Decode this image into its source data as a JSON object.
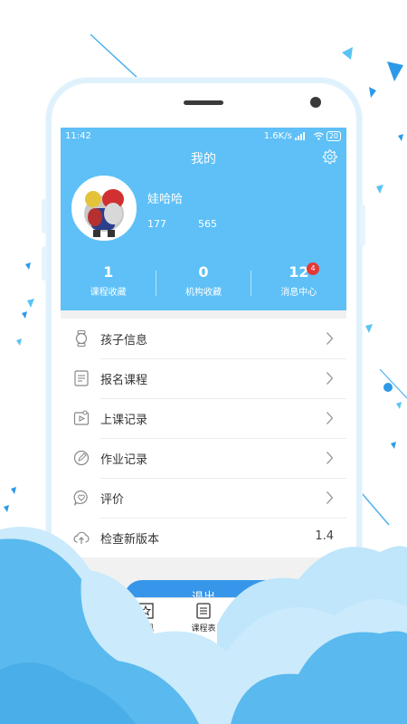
{
  "statusbar": {
    "time": "11:42",
    "network_speed": "1.6K/s",
    "battery": "20"
  },
  "header": {
    "title": "我的",
    "user_name": "娃哈哈",
    "stat_a": "177",
    "stat_b": "565"
  },
  "counts": [
    {
      "value": "1",
      "label": "课程收藏"
    },
    {
      "value": "0",
      "label": "机构收藏"
    },
    {
      "value": "12",
      "label": "消息中心",
      "badge": "4"
    }
  ],
  "menu": [
    {
      "label": "孩子信息",
      "icon": "watch-icon"
    },
    {
      "label": "报名课程",
      "icon": "form-icon"
    },
    {
      "label": "上课记录",
      "icon": "media-icon"
    },
    {
      "label": "作业记录",
      "icon": "edit-circle-icon"
    },
    {
      "label": "评价",
      "icon": "heart-chat-icon"
    },
    {
      "label": "检查新版本",
      "icon": "cloud-upload-icon",
      "value": "1.4"
    }
  ],
  "logout_label": "退出",
  "tabs": [
    {
      "label": "",
      "icon": "home-icon"
    },
    {
      "label": "发现",
      "icon": "discover-icon"
    },
    {
      "label": "课程表",
      "icon": "schedule-icon"
    }
  ],
  "colors": {
    "header": "#5ec0f7",
    "button": "#3796ea",
    "badge": "#e53935",
    "cloud_dark": "#5ab9ee",
    "cloud_light": "#bfe6fa"
  }
}
